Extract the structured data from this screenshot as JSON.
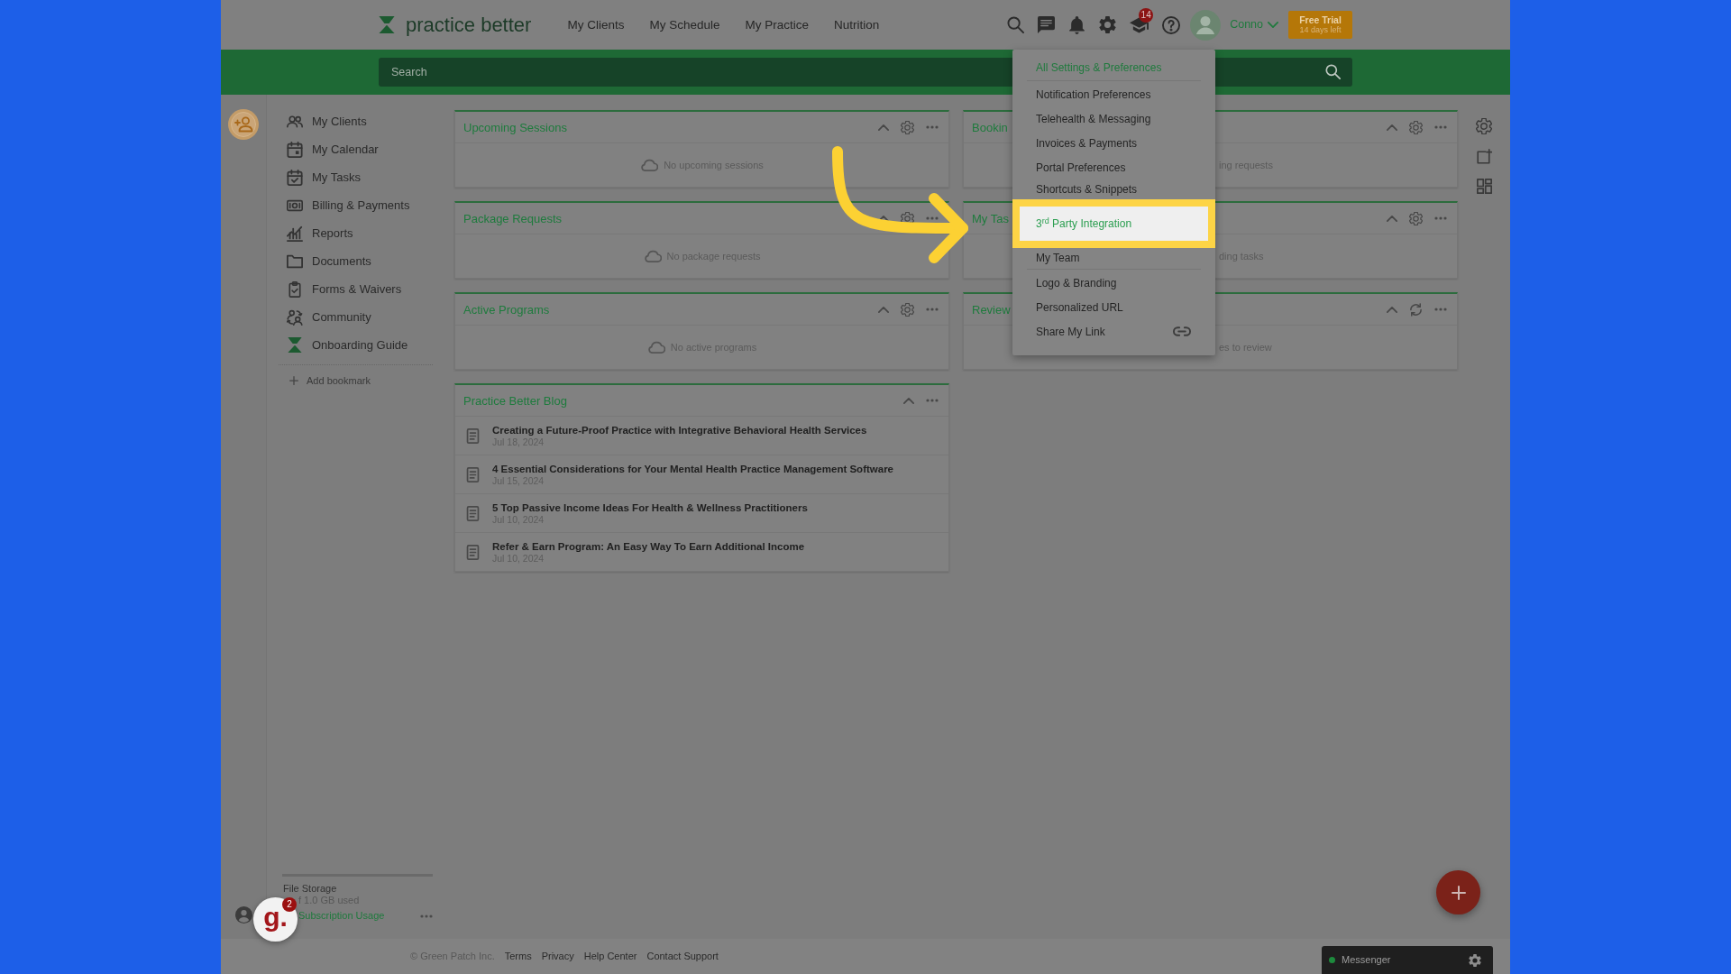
{
  "header": {
    "logo": "practice better",
    "nav": [
      "My Clients",
      "My Schedule",
      "My Practice",
      "Nutrition"
    ],
    "badge": "14",
    "user": "Conno",
    "trial": {
      "title": "Free Trial",
      "subtitle": "14 days left"
    }
  },
  "search": {
    "placeholder": "Search"
  },
  "sidebar": {
    "items": [
      "My Clients",
      "My Calendar",
      "My Tasks",
      "Billing & Payments",
      "Reports",
      "Documents",
      "Forms & Waivers",
      "Community",
      "Onboarding Guide"
    ],
    "add_bookmark": "Add bookmark"
  },
  "storage": {
    "title": "File Storage",
    "usage": "f 1.0 GB used",
    "level": 0,
    "link": "Subscription Usage"
  },
  "help_widget": {
    "logo": "g.",
    "badge": "2"
  },
  "widgets": {
    "left": [
      {
        "kind": "empty",
        "title": "Upcoming Sessions",
        "message": "No upcoming sessions"
      },
      {
        "kind": "empty",
        "title": "Package Requests",
        "message": "No package requests"
      },
      {
        "kind": "empty",
        "title": "Active Programs",
        "message": "No active programs"
      },
      {
        "kind": "blog",
        "title": "Practice Better Blog",
        "posts": [
          {
            "title": "Creating a Future-Proof Practice with Integrative Behavioral Health Services",
            "date": "Jul 18, 2024"
          },
          {
            "title": "4 Essential Considerations for Your Mental Health Practice Management Software",
            "date": "Jul 15, 2024"
          },
          {
            "title": "5 Top Passive Income Ideas For Health & Wellness Practitioners",
            "date": "Jul 10, 2024"
          },
          {
            "title": "Refer & Earn Program: An Easy Way To Earn Additional Income",
            "date": "Jul 10, 2024"
          }
        ]
      }
    ],
    "right": [
      {
        "kind": "empty",
        "title": "Bookin",
        "message": "ing requests"
      },
      {
        "kind": "empty",
        "title": "My Tas",
        "message": "ding tasks"
      },
      {
        "kind": "empty",
        "title": "Review",
        "message": "es to review"
      }
    ]
  },
  "settings_menu": {
    "sections": [
      {
        "items": [
          {
            "kind": "heading",
            "label": "All Settings & Preferences",
            "highlighted": false
          }
        ]
      },
      {
        "items": [
          {
            "kind": "plain",
            "label": "Notification Preferences",
            "highlighted": false
          },
          {
            "kind": "plain",
            "label": "Telehealth & Messaging",
            "highlighted": false
          },
          {
            "kind": "plain",
            "label": "Invoices & Payments",
            "highlighted": false
          },
          {
            "kind": "plain",
            "label": "Portal Preferences",
            "highlighted": false
          },
          {
            "kind": "plain",
            "label": "Shortcuts & Snippets",
            "highlighted": false
          },
          {
            "kind": "plain",
            "label": "3$^{rd}$ Party Integration",
            "highlighted": true
          },
          {
            "kind": "plain",
            "label": "My Team",
            "highlighted": false
          }
        ]
      },
      {
        "items": [
          {
            "kind": "plain",
            "label": "Logo & Branding",
            "highlighted": false
          },
          {
            "kind": "plain",
            "label": "Personalized URL",
            "highlighted": false
          },
          {
            "kind": "icon",
            "label": "Share My Link",
            "highlighted": false
          }
        ]
      }
    ]
  },
  "footer": {
    "copyright": "© Green Patch Inc.",
    "links": [
      "Terms",
      "Privacy",
      "Help Center",
      "Contact Support"
    ]
  },
  "messenger": {
    "label": "Messenger",
    "online": true
  }
}
